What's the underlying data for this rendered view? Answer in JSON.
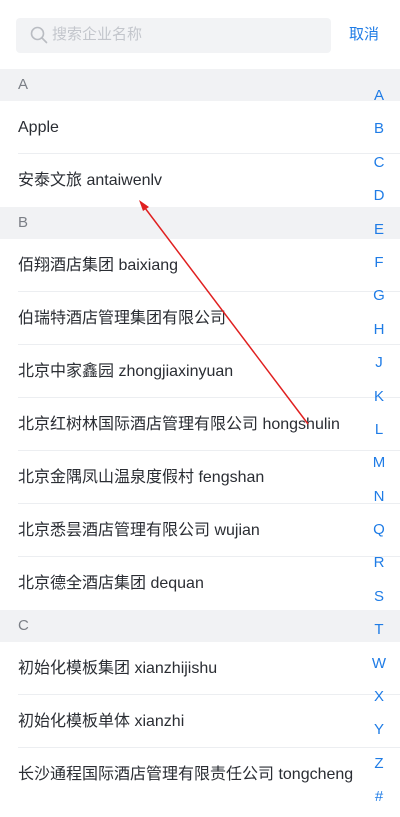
{
  "search": {
    "placeholder": "搜索企业名称",
    "cancel_label": "取消"
  },
  "sections": [
    {
      "letter": "A",
      "items": [
        "Apple",
        "安泰文旅  antaiwenlv"
      ]
    },
    {
      "letter": "B",
      "items": [
        "佰翔酒店集团  baixiang",
        "伯瑞特酒店管理集团有限公司",
        "北京中家鑫园  zhongjiaxinyuan",
        "北京红树林国际酒店管理有限公司  hongshulin",
        "北京金隅凤山温泉度假村  fengshan",
        "北京悉昙酒店管理有限公司  wujian",
        "北京德全酒店集团  dequan"
      ]
    },
    {
      "letter": "C",
      "items": [
        "初始化模板集团  xianzhijishu",
        "初始化模板单体  xianzhi",
        "长沙通程国际酒店管理有限责任公司  tongcheng"
      ]
    }
  ],
  "index_letters": [
    "A",
    "B",
    "C",
    "D",
    "E",
    "F",
    "G",
    "H",
    "J",
    "K",
    "L",
    "M",
    "N",
    "Q",
    "R",
    "S",
    "T",
    "W",
    "X",
    "Y",
    "Z",
    "#"
  ],
  "colors": {
    "accent": "#1f7ce6",
    "annotation_arrow": "#e02020"
  },
  "icons": {
    "search": "search-icon"
  }
}
